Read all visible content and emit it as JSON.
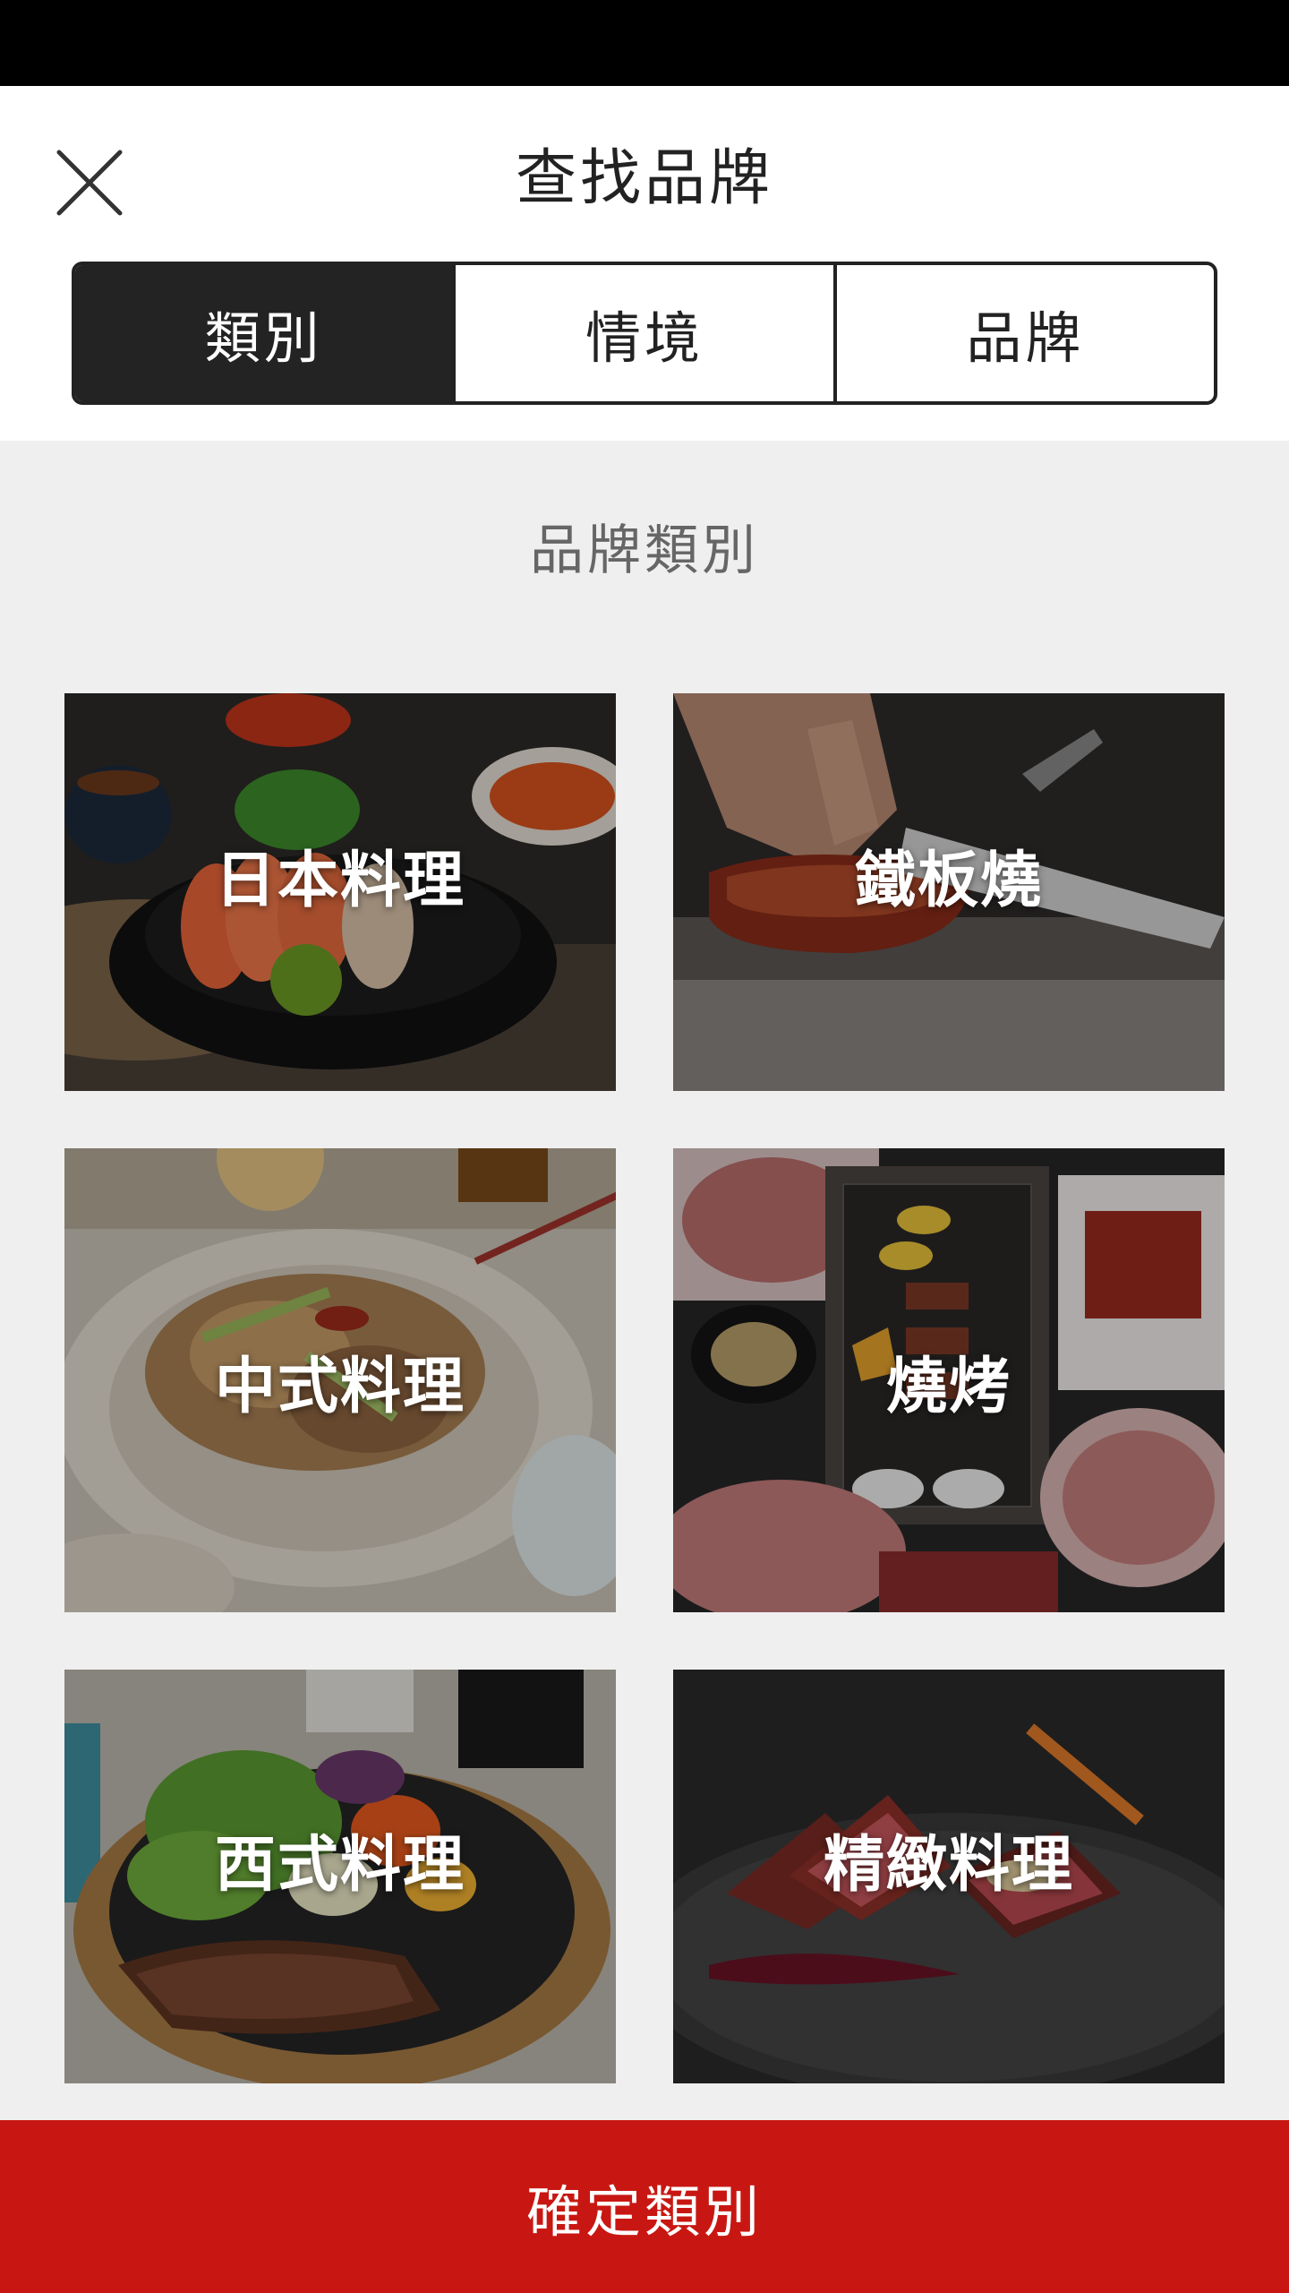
{
  "header": {
    "title": "查找品牌",
    "close_icon": "close-icon",
    "tabs": [
      {
        "label": "類別",
        "active": true
      },
      {
        "label": "情境",
        "active": false
      },
      {
        "label": "品牌",
        "active": false
      }
    ]
  },
  "main": {
    "section_title": "品牌類別",
    "categories": [
      {
        "label": "日本料理"
      },
      {
        "label": "鐵板燒"
      },
      {
        "label": "中式料理"
      },
      {
        "label": "燒烤"
      },
      {
        "label": "西式料理"
      },
      {
        "label": "精緻料理"
      }
    ]
  },
  "footer": {
    "confirm_label": "確定類別"
  },
  "colors": {
    "accent": "#c81712",
    "active_tab": "#232323",
    "background": "#efefef"
  }
}
